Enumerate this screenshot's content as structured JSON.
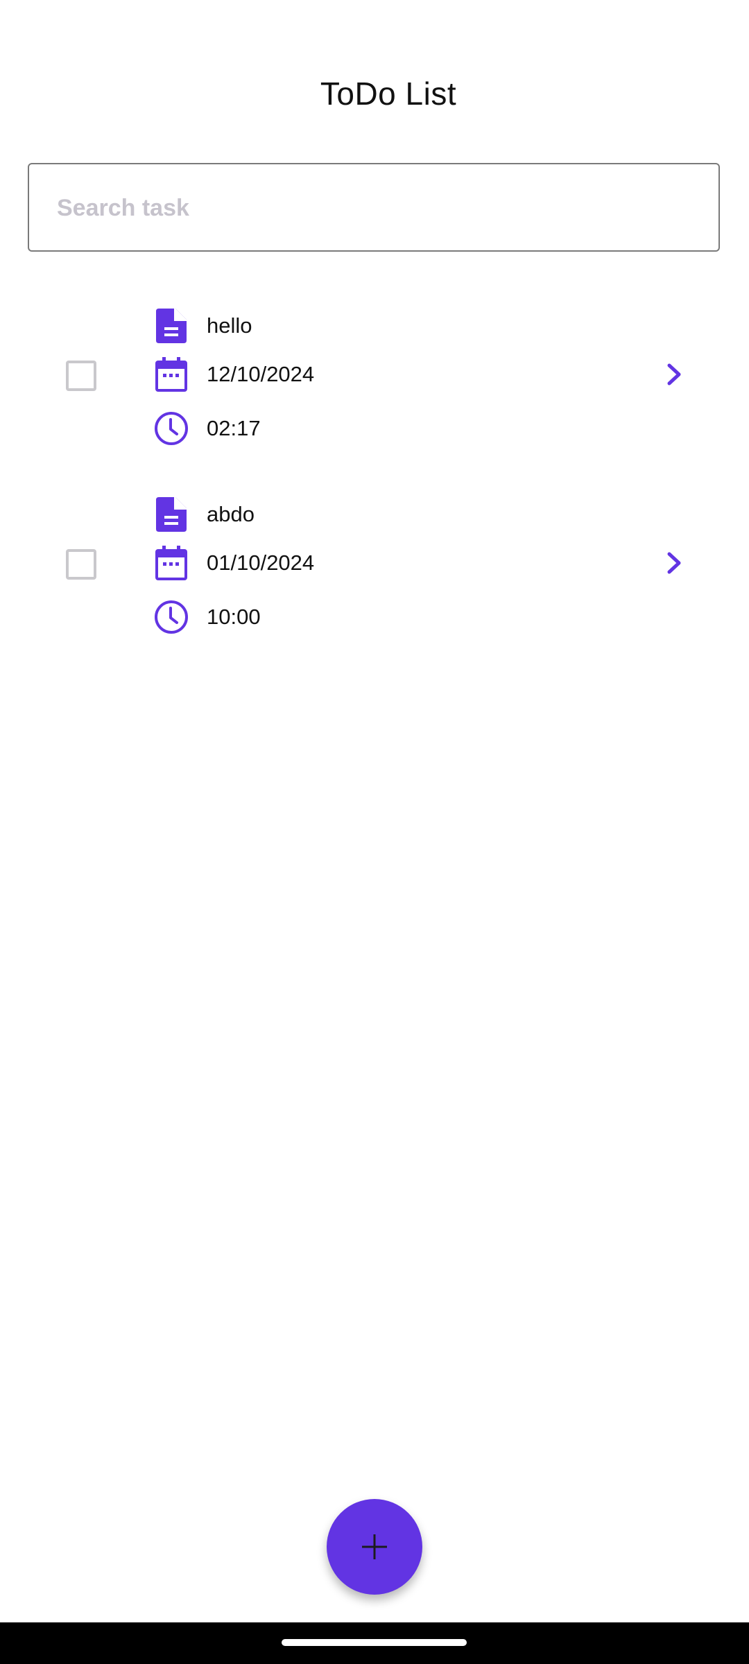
{
  "app": {
    "title": "ToDo List"
  },
  "search": {
    "placeholder": "Search task",
    "value": ""
  },
  "tasks": [
    {
      "name": "hello",
      "date": "12/10/2024",
      "time": "02:17",
      "checked": false
    },
    {
      "name": "abdo",
      "date": "01/10/2024",
      "time": "10:00",
      "checked": false
    }
  ],
  "icons": {
    "task_name": "document-icon",
    "task_date": "calendar-icon",
    "task_time": "clock-icon",
    "open_task": "chevron-right-icon",
    "add_task": "plus-icon"
  },
  "colors": {
    "accent": "#6234e3",
    "checkbox_border": "#c9c8cc",
    "placeholder": "#c6c3cc",
    "text": "#111111"
  }
}
